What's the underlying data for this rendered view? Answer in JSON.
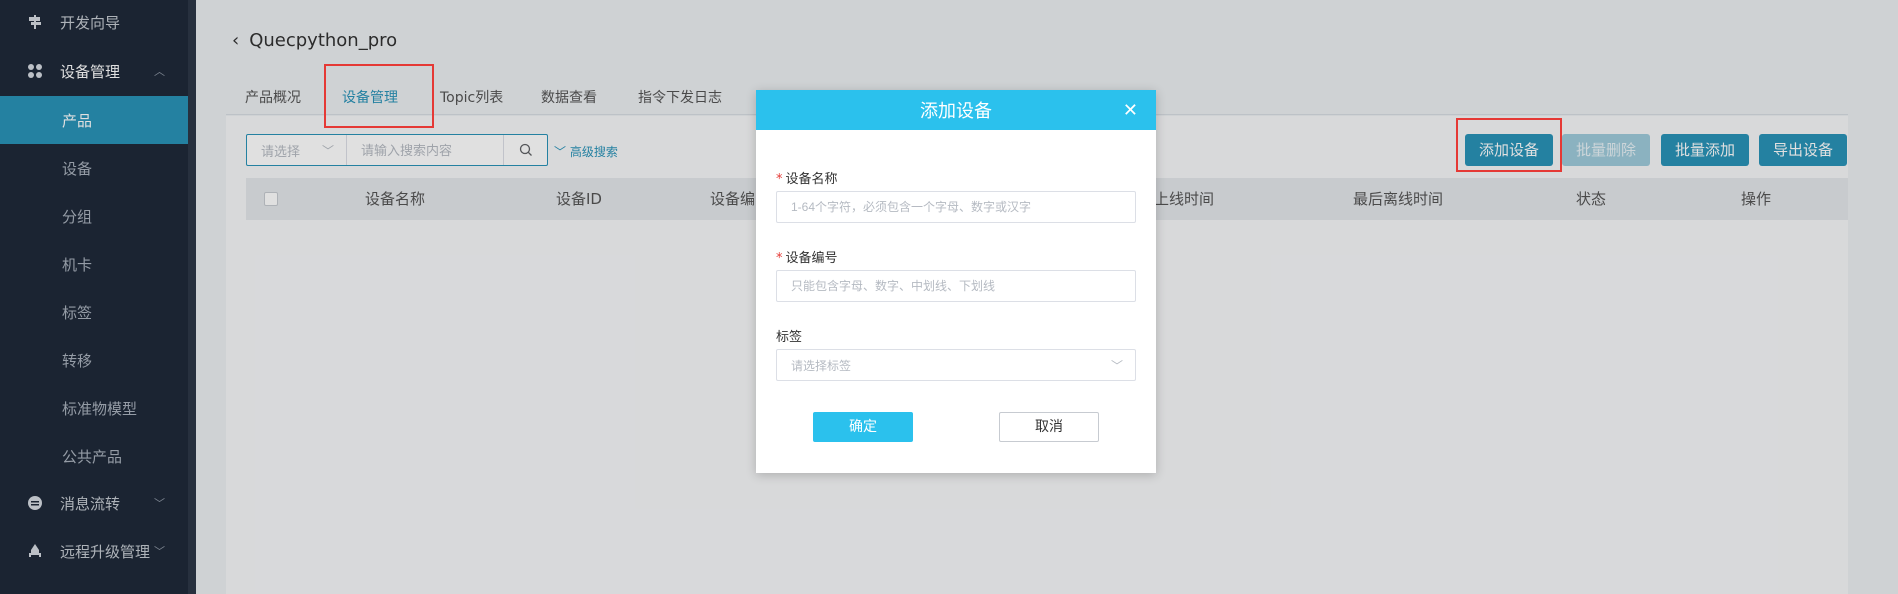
{
  "sidebar": {
    "items": [
      {
        "label": "开发向导",
        "icon": "signpost-icon"
      },
      {
        "label": "设备管理",
        "icon": "grid-icon"
      },
      {
        "label": "消息流转",
        "icon": "message-icon"
      },
      {
        "label": "远程升级管理",
        "icon": "rocket-icon"
      }
    ],
    "sub_items": [
      {
        "label": "产品"
      },
      {
        "label": "设备"
      },
      {
        "label": "分组"
      },
      {
        "label": "机卡"
      },
      {
        "label": "标签"
      },
      {
        "label": "转移"
      },
      {
        "label": "标准物模型"
      },
      {
        "label": "公共产品"
      }
    ]
  },
  "header": {
    "back_title": "Quecpython_pro"
  },
  "tabs": [
    {
      "label": "产品概况"
    },
    {
      "label": "设备管理"
    },
    {
      "label": "Topic列表"
    },
    {
      "label": "数据查看"
    },
    {
      "label": "指令下发日志"
    }
  ],
  "search": {
    "select_placeholder": "请选择",
    "input_placeholder": "请输入搜索内容",
    "advanced_label": "高级搜索"
  },
  "toolbar": {
    "add_device": "添加设备",
    "batch_delete": "批量删除",
    "batch_add": "批量添加",
    "export_devices": "导出设备"
  },
  "table": {
    "columns": [
      "设备名称",
      "设备ID",
      "设备编",
      "上线时间",
      "最后离线时间",
      "状态",
      "操作"
    ]
  },
  "dialog": {
    "title": "添加设备",
    "fields": {
      "name_label": "设备名称",
      "name_placeholder": "1-64个字符，必须包含一个字母、数字或汉字",
      "number_label": "设备编号",
      "number_placeholder": "只能包含字母、数字、中划线、下划线",
      "tag_label": "标签",
      "tag_placeholder": "请选择标签"
    },
    "confirm": "确定",
    "cancel": "取消"
  },
  "colors": {
    "accent": "#2a93b8",
    "dialog_header": "#2bc1ed",
    "sidebar_bg": "#1f2a3a",
    "highlight": "#e53935"
  }
}
